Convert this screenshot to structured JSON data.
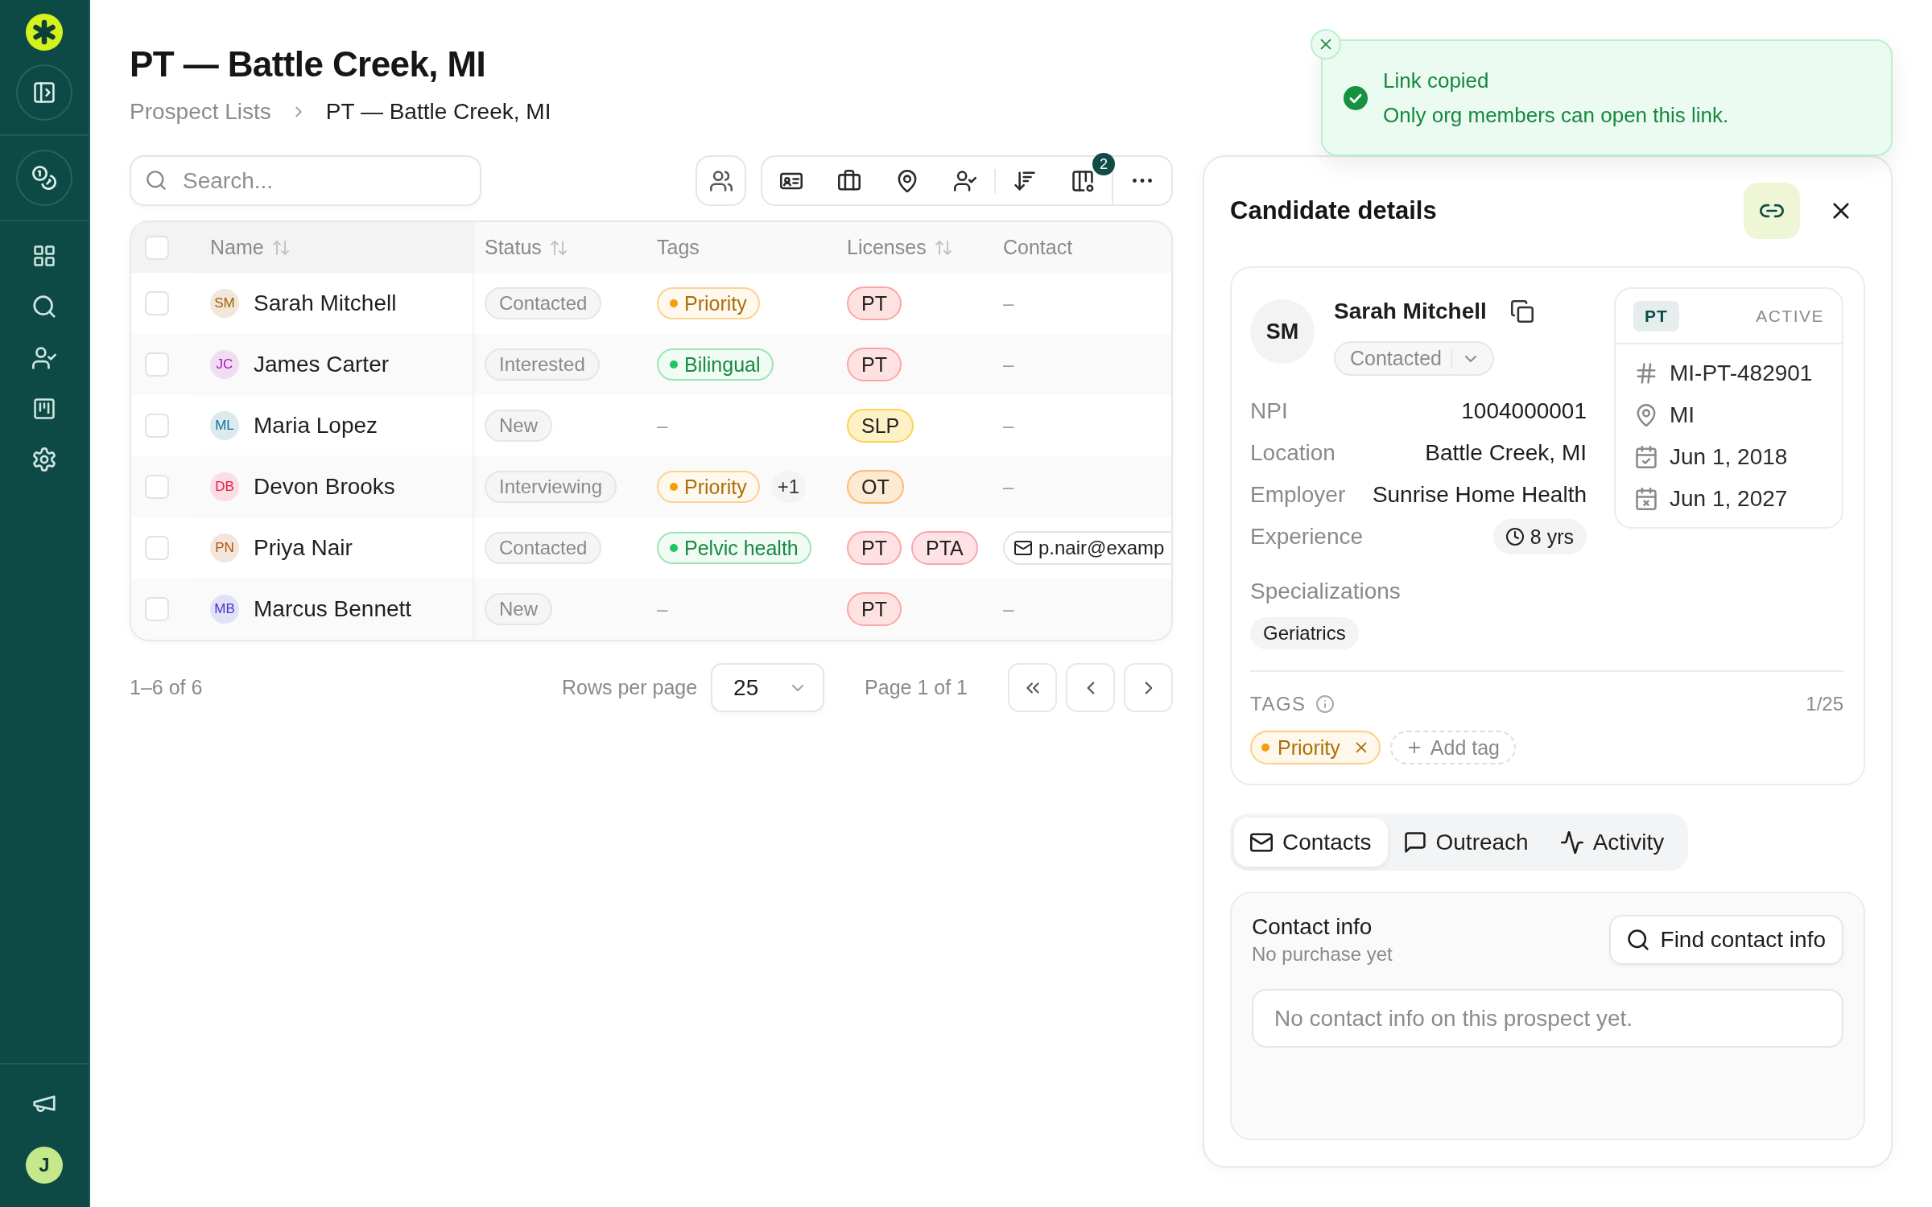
{
  "sidebar": {
    "user_initial": "J"
  },
  "page": {
    "title": "PT — Battle Creek, MI",
    "breadcrumb": [
      {
        "label": "Prospect Lists",
        "current": false
      },
      {
        "label": "PT — Battle Creek, MI",
        "current": true
      }
    ]
  },
  "search": {
    "placeholder": "Search..."
  },
  "toolbar": {
    "columns_badge": "2"
  },
  "table": {
    "all_checked": false,
    "columns": [
      {
        "label": "Name",
        "sortable": true
      },
      {
        "label": "Status",
        "sortable": true
      },
      {
        "label": "Tags",
        "sortable": false
      },
      {
        "label": "Licenses",
        "sortable": true
      },
      {
        "label": "Contact",
        "sortable": false
      }
    ],
    "rows": [
      {
        "checked": false,
        "initials": "SM",
        "color": "#a16207",
        "name": "Sarah Mitchell",
        "status": "Contacted",
        "tags": {
          "kind": "list",
          "items": [
            {
              "label": "Priority",
              "color": "#f59e0b"
            }
          ]
        },
        "licenses": [
          {
            "label": "PT",
            "color": "#fca5a5"
          }
        ],
        "contact": {
          "kind": "none",
          "text": "–"
        }
      },
      {
        "checked": false,
        "initials": "JC",
        "color": "#a21caf",
        "name": "James Carter",
        "status": "Interested",
        "tags": {
          "kind": "list",
          "items": [
            {
              "label": "Bilingual",
              "color": "#22c55e"
            }
          ]
        },
        "licenses": [
          {
            "label": "PT",
            "color": "#fca5a5"
          }
        ],
        "contact": {
          "kind": "none",
          "text": "–"
        }
      },
      {
        "checked": false,
        "initials": "ML",
        "color": "#0e7490",
        "name": "Maria Lopez",
        "status": "New",
        "tags": {
          "kind": "none",
          "text": "–"
        },
        "licenses": [
          {
            "label": "SLP",
            "color": "#fcd34d"
          }
        ],
        "contact": {
          "kind": "none",
          "text": "–"
        }
      },
      {
        "checked": false,
        "initials": "DB",
        "color": "#e11d48",
        "name": "Devon Brooks",
        "status": "Interviewing",
        "tags": {
          "kind": "list",
          "items": [
            {
              "label": "Priority",
              "color": "#f59e0b"
            }
          ],
          "more": "+1"
        },
        "licenses": [
          {
            "label": "OT",
            "color": "#fdba74"
          }
        ],
        "contact": {
          "kind": "none",
          "text": "–"
        }
      },
      {
        "checked": false,
        "initials": "PN",
        "color": "#b45309",
        "name": "Priya Nair",
        "status": "Contacted",
        "tags": {
          "kind": "list",
          "items": [
            {
              "label": "Pelvic health",
              "color": "#22c55e"
            }
          ]
        },
        "licenses": [
          {
            "label": "PT",
            "color": "#fca5a5"
          },
          {
            "label": "PTA",
            "color": "#fda4af"
          }
        ],
        "contact": {
          "kind": "email",
          "text": "p.nair@examp"
        }
      },
      {
        "checked": false,
        "initials": "MB",
        "color": "#4338ca",
        "name": "Marcus Bennett",
        "status": "New",
        "tags": {
          "kind": "none",
          "text": "–"
        },
        "licenses": [
          {
            "label": "PT",
            "color": "#fca5a5"
          }
        ],
        "contact": {
          "kind": "none",
          "text": "–"
        }
      }
    ]
  },
  "pagination": {
    "range": "1–6 of 6",
    "rows_per_page_label": "Rows per page",
    "rows_per_page": "25",
    "page_label": "Page 1 of 1"
  },
  "toast": {
    "title": "Link copied",
    "message": "Only org members can open this link."
  },
  "details": {
    "title": "Candidate details",
    "profile": {
      "initials": "SM",
      "name": "Sarah Mitchell",
      "status": "Contacted",
      "fields": [
        {
          "kind": "text",
          "label": "NPI",
          "value": "1004000001"
        },
        {
          "kind": "text",
          "label": "Location",
          "value": "Battle Creek, MI"
        },
        {
          "kind": "text",
          "label": "Employer",
          "value": "Sunrise Home Health"
        },
        {
          "kind": "duration",
          "label": "Experience",
          "value": "8 yrs"
        }
      ],
      "license": {
        "type": "PT",
        "status": "ACTIVE",
        "items": [
          {
            "kind": "number",
            "text": "MI-PT-482901"
          },
          {
            "kind": "state",
            "text": "MI"
          },
          {
            "kind": "issued",
            "text": "Jun 1, 2018"
          },
          {
            "kind": "expires",
            "text": "Jun 1, 2027"
          }
        ]
      },
      "specializations": {
        "label": "Specializations",
        "items": [
          "Geriatrics"
        ]
      },
      "tags": {
        "label": "TAGS",
        "count": "1/25",
        "items": [
          {
            "label": "Priority",
            "color": "#f59e0b"
          }
        ],
        "add_label": "Add tag"
      }
    },
    "tabs": [
      {
        "kind": "mail",
        "label": "Contacts",
        "selected": true
      },
      {
        "kind": "message",
        "label": "Outreach",
        "selected": false
      },
      {
        "kind": "activity",
        "label": "Activity",
        "selected": false
      }
    ],
    "contact_info": {
      "title": "Contact info",
      "subtitle": "No purchase yet",
      "button": "Find contact info",
      "empty_text": "No contact info on this prospect yet."
    }
  }
}
